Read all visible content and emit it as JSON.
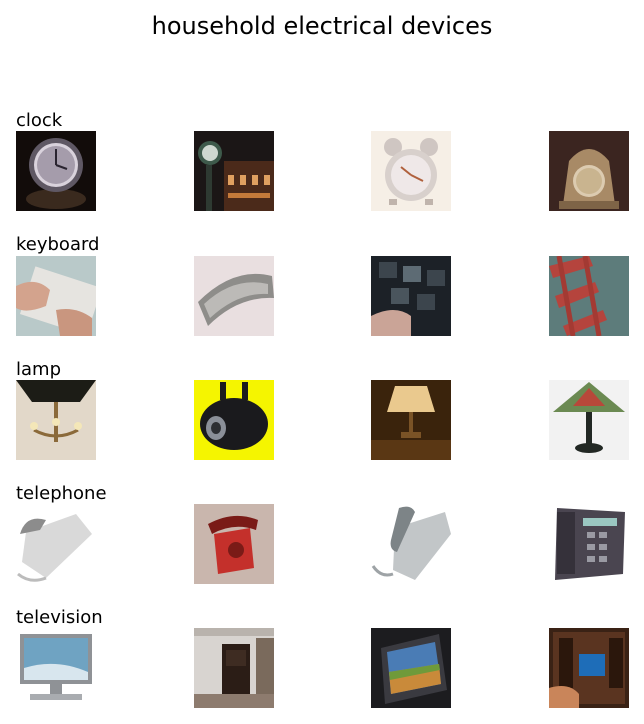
{
  "figure": {
    "title": "household electrical devices"
  },
  "rows": [
    {
      "label": "clock",
      "images": [
        {
          "subject": "wall clock face lit in the dark",
          "palette": [
            "#120c0a",
            "#8a7f8f",
            "#d9d2dc"
          ]
        },
        {
          "subject": "street clock in front of lit building at night",
          "palette": [
            "#1b1616",
            "#6b3c24",
            "#3e5a4b"
          ]
        },
        {
          "subject": "alarm clock with twin bells",
          "palette": [
            "#f6efe6",
            "#d8d0cc",
            "#e8c7a3"
          ]
        },
        {
          "subject": "ornate gilded mantel clock",
          "palette": [
            "#3b2520",
            "#a88a66",
            "#dccbb0"
          ]
        }
      ]
    },
    {
      "label": "keyboard",
      "images": [
        {
          "subject": "hands typing on white keyboard",
          "palette": [
            "#b9c9c9",
            "#e6e4e0",
            "#d3a38d"
          ]
        },
        {
          "subject": "curved ergonomic keyboard",
          "palette": [
            "#e9dfe0",
            "#8e8d8a",
            "#bcbab7"
          ]
        },
        {
          "subject": "finger pressing dark keys",
          "palette": [
            "#1c2127",
            "#5d6b74",
            "#caa497"
          ]
        },
        {
          "subject": "close-up of red keyboard frame",
          "palette": [
            "#5d7c7b",
            "#b5443d",
            "#3d4c4f"
          ]
        }
      ]
    },
    {
      "label": "lamp",
      "images": [
        {
          "subject": "chandelier under dark shade",
          "palette": [
            "#1c1c16",
            "#e2d8c9",
            "#8b6a3a"
          ]
        },
        {
          "subject": "black spotlight on yellow background",
          "palette": [
            "#f5f500",
            "#1a1a1d",
            "#8a8f98"
          ]
        },
        {
          "subject": "table lamp glowing in dim room",
          "palette": [
            "#3a230c",
            "#eac98e",
            "#7a5326"
          ]
        },
        {
          "subject": "stained glass tiffany lamp",
          "palette": [
            "#f2f2f2",
            "#6b8a52",
            "#222824"
          ]
        }
      ]
    },
    {
      "label": "telephone",
      "images": [
        {
          "subject": "white corded desk telephone",
          "palette": [
            "#ffffff",
            "#d9d9d9",
            "#8c8c8c"
          ]
        },
        {
          "subject": "red rotary telephone",
          "palette": [
            "#c9b6ad",
            "#c4302b",
            "#7a1b17"
          ]
        },
        {
          "subject": "light grey office telephone",
          "palette": [
            "#ffffff",
            "#c2c6c8",
            "#7d8487"
          ]
        },
        {
          "subject": "dark grey office telephone",
          "palette": [
            "#ffffff",
            "#4a4550",
            "#9a9aa3"
          ]
        }
      ]
    },
    {
      "label": "television",
      "images": [
        {
          "subject": "flat panel television on stand",
          "palette": [
            "#ffffff",
            "#8f9296",
            "#6fa3c2"
          ]
        },
        {
          "subject": "cabinet television in living room",
          "palette": [
            "#d8d4d0",
            "#2b1d16",
            "#7a6a5c"
          ]
        },
        {
          "subject": "tilted television showing landscape",
          "palette": [
            "#1c1c1f",
            "#c98a3a",
            "#4a7cb5"
          ]
        },
        {
          "subject": "entertainment center with blue screen",
          "palette": [
            "#3a2215",
            "#1e6db8",
            "#c9855a"
          ]
        }
      ]
    }
  ]
}
